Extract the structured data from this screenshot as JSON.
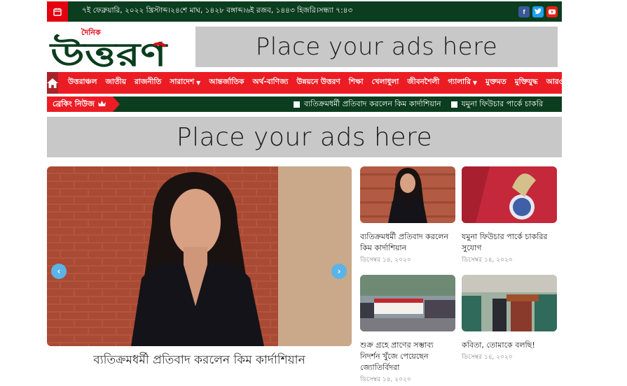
{
  "topbar": {
    "date_text": "৭ই ফেব্রুয়ারি, ২০২২ খ্রিস্টাব্দ।২৪শে মাঘ, ১৪২৮ বঙ্গাব্দ।৬ই রজব, ১৪৪৩ হিজরি।সন্ধ্যা ৭:৪৩",
    "socials": [
      "facebook-icon",
      "twitter-icon",
      "youtube-icon"
    ]
  },
  "logo": {
    "small": "দৈনিক",
    "big": "উত্তরণ"
  },
  "ads": {
    "top": "Place your ads here",
    "middle": "Place your ads here"
  },
  "nav": {
    "items": [
      {
        "label": "উত্তরাঞ্চল",
        "dropdown": false
      },
      {
        "label": "জাতীয়",
        "dropdown": false
      },
      {
        "label": "রাজনীতি",
        "dropdown": false
      },
      {
        "label": "সারাদেশ",
        "dropdown": true
      },
      {
        "label": "আন্তর্জাতিক",
        "dropdown": false
      },
      {
        "label": "অর্থ-বাণিজ্য",
        "dropdown": false
      },
      {
        "label": "উন্নয়নে উত্তরণ",
        "dropdown": false
      },
      {
        "label": "শিক্ষা",
        "dropdown": false
      },
      {
        "label": "খেলাধুলা",
        "dropdown": false
      },
      {
        "label": "জীবনশৈলী",
        "dropdown": false
      },
      {
        "label": "গ্যালারি",
        "dropdown": true
      },
      {
        "label": "মুক্তমত",
        "dropdown": false
      },
      {
        "label": "মুক্তিযুদ্ধ",
        "dropdown": false
      },
      {
        "label": "আরও",
        "dropdown": true
      }
    ]
  },
  "breaking": {
    "label": "ব্রেকিং নিউজ",
    "items": [
      "ব্যতিক্রমধর্মী প্রতিবাদ করলেন কিম কার্দাশিয়ান",
      "যমুনা ফিউচার পার্কে চাকরি"
    ]
  },
  "slider": {
    "caption": "ব্যতিক্রমধর্মী প্রতিবাদ করলেন কিম কার্দাশিয়ান",
    "prev": "‹",
    "next": "›"
  },
  "cards": [
    {
      "title": "ব্যতিক্রমধর্মী প্রতিবাদ করলেন কিম কার্দাশিয়ান",
      "date": "ডিসেম্বর ১৪, ২০২০"
    },
    {
      "title": "যমুনা ফিউচার পার্কে চাকরির সুযোগ",
      "date": "ডিসেম্বর ১৪, ২০২০"
    },
    {
      "title": "শুক্র গ্রহে প্রাণের সম্ভাব্য নিদর্শন খুঁজে পেয়েছেন জ্যোতির্বিদরা",
      "date": "ডিসেম্বর ১৪, ২০২০"
    },
    {
      "title": "কবিতা, তোমাকে বলছি!",
      "date": "ডিসেম্বর ১৪, ২০২০"
    }
  ],
  "colors": {
    "brand_red": "#ec1c24",
    "brand_green": "#0b3d1f",
    "home_red": "#a9222a"
  }
}
